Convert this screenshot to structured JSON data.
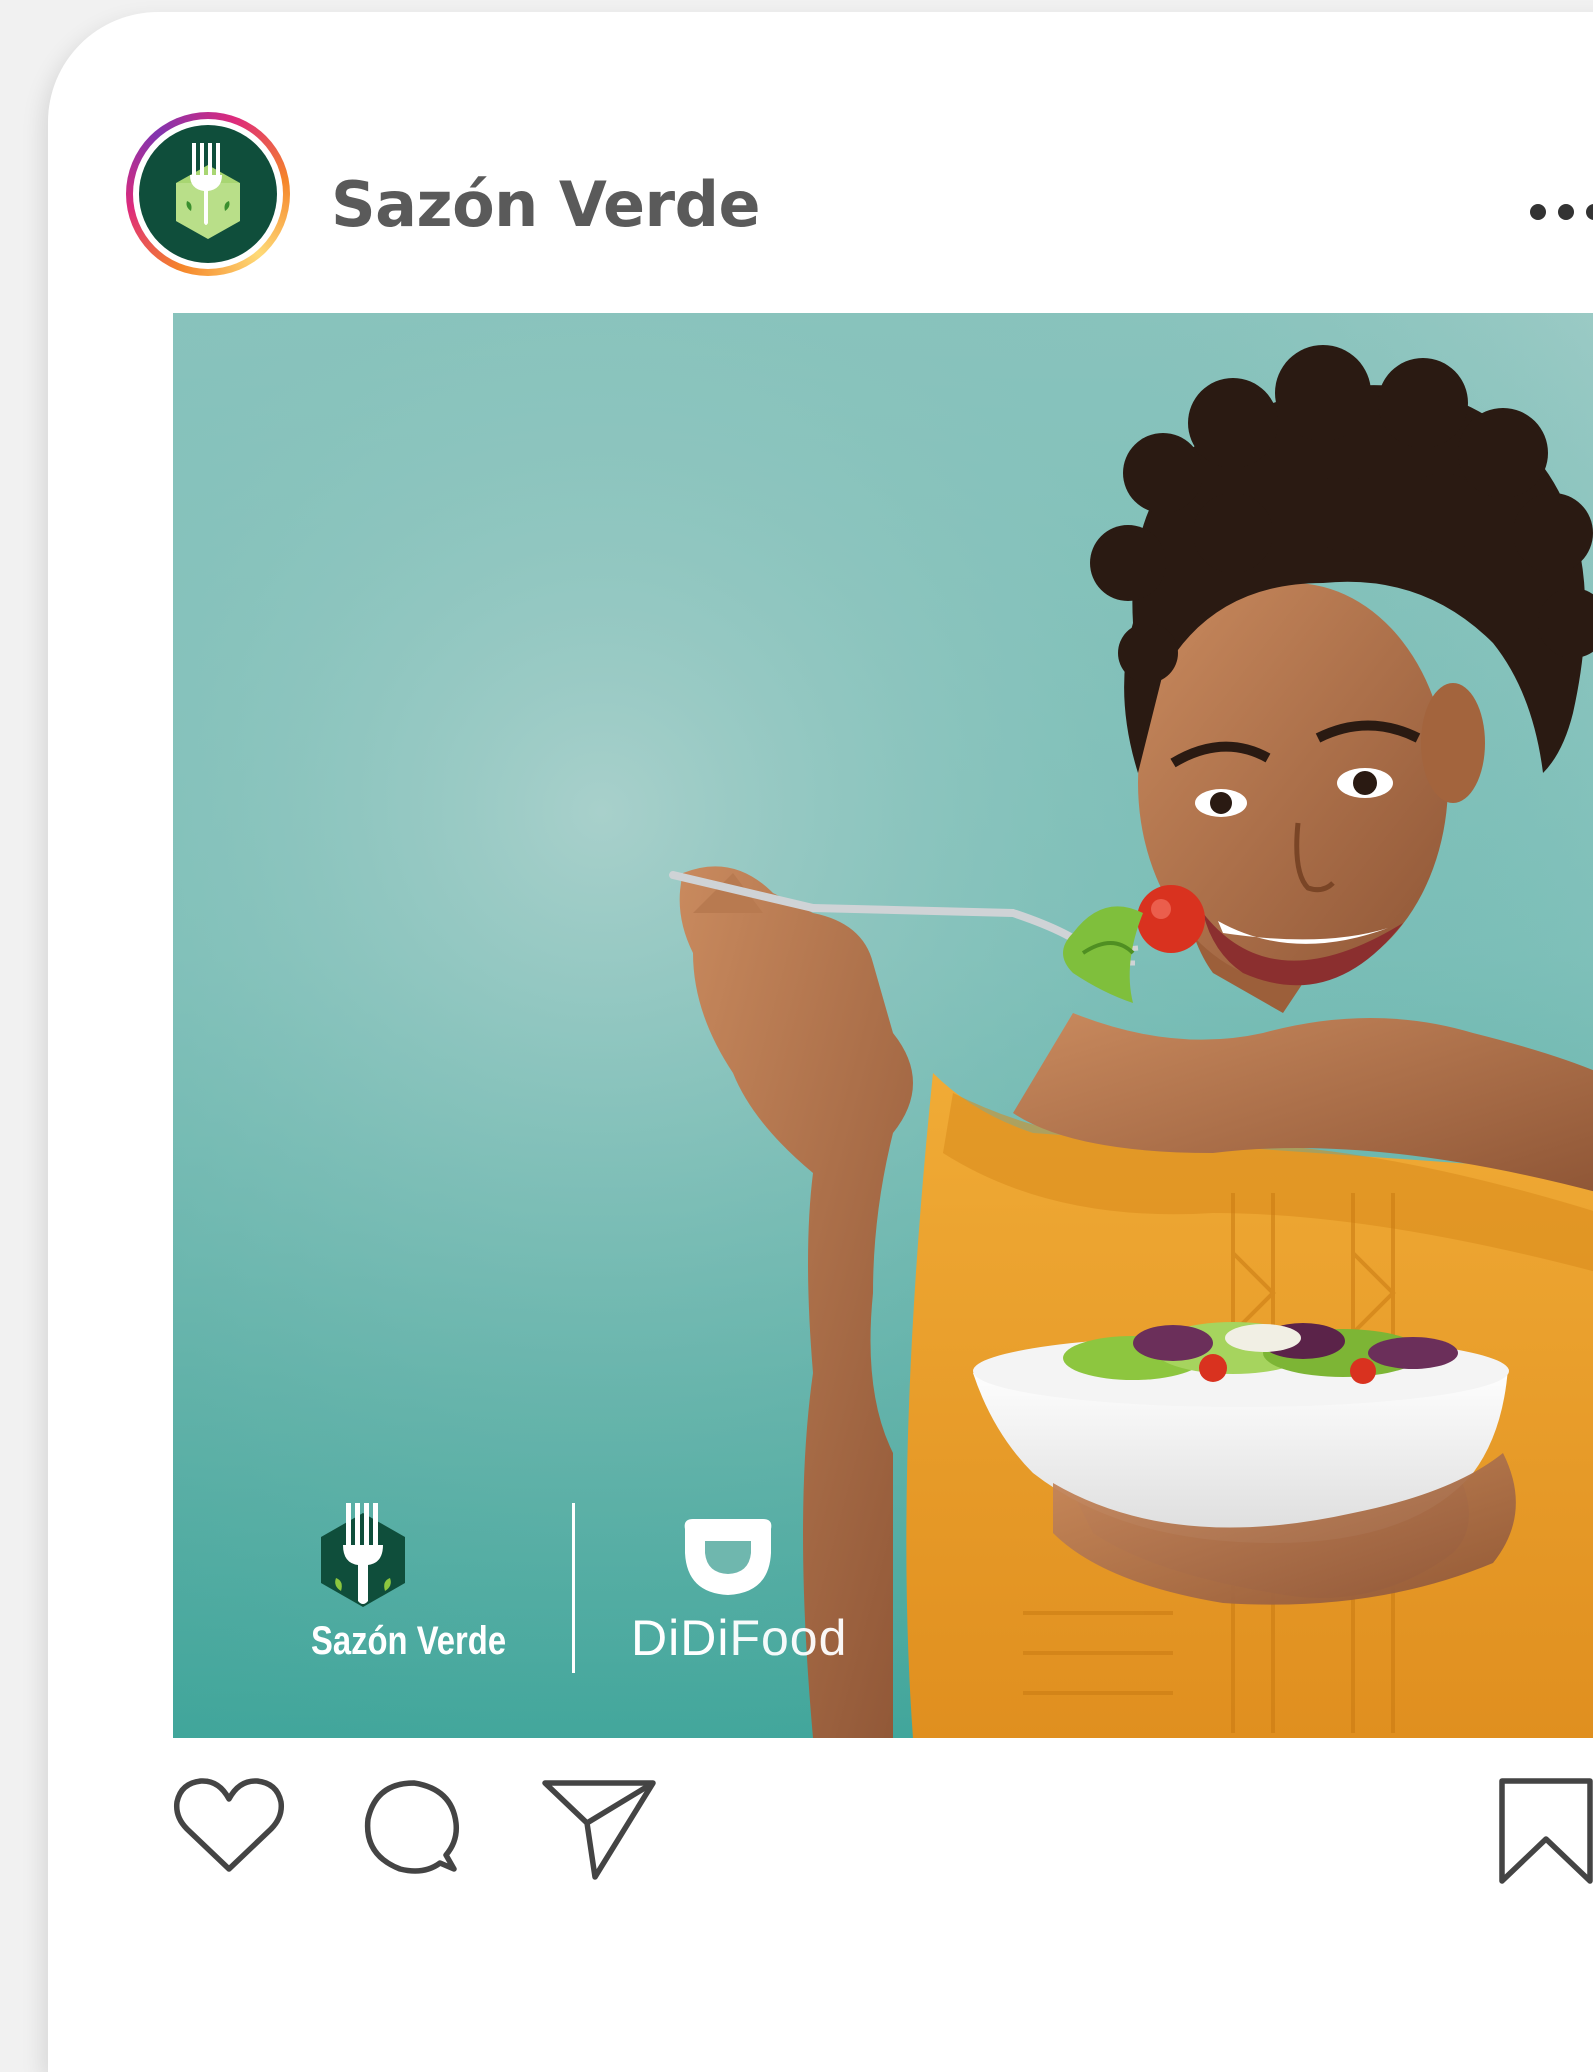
{
  "post": {
    "account_name": "Sazón Verde",
    "avatar_icon": "sazon-verde-logo-icon",
    "more_icon": "more-horizontal-icon"
  },
  "photo": {
    "brand_watermark": {
      "left_brand": "Sazón Verde",
      "right_brand_prefix": "DiDi",
      "right_brand_suffix": "Food"
    }
  },
  "actions": {
    "like_icon": "heart-icon",
    "comment_icon": "comment-icon",
    "share_icon": "send-icon",
    "save_icon": "bookmark-icon"
  },
  "colors": {
    "brand_green": "#0f4e3b",
    "leaf_green": "#8cc63f",
    "teal_background": "#7ec0b9",
    "shirt_orange": "#e9a22e",
    "icon_stroke": "#444444",
    "username": "#5a5a5a"
  }
}
